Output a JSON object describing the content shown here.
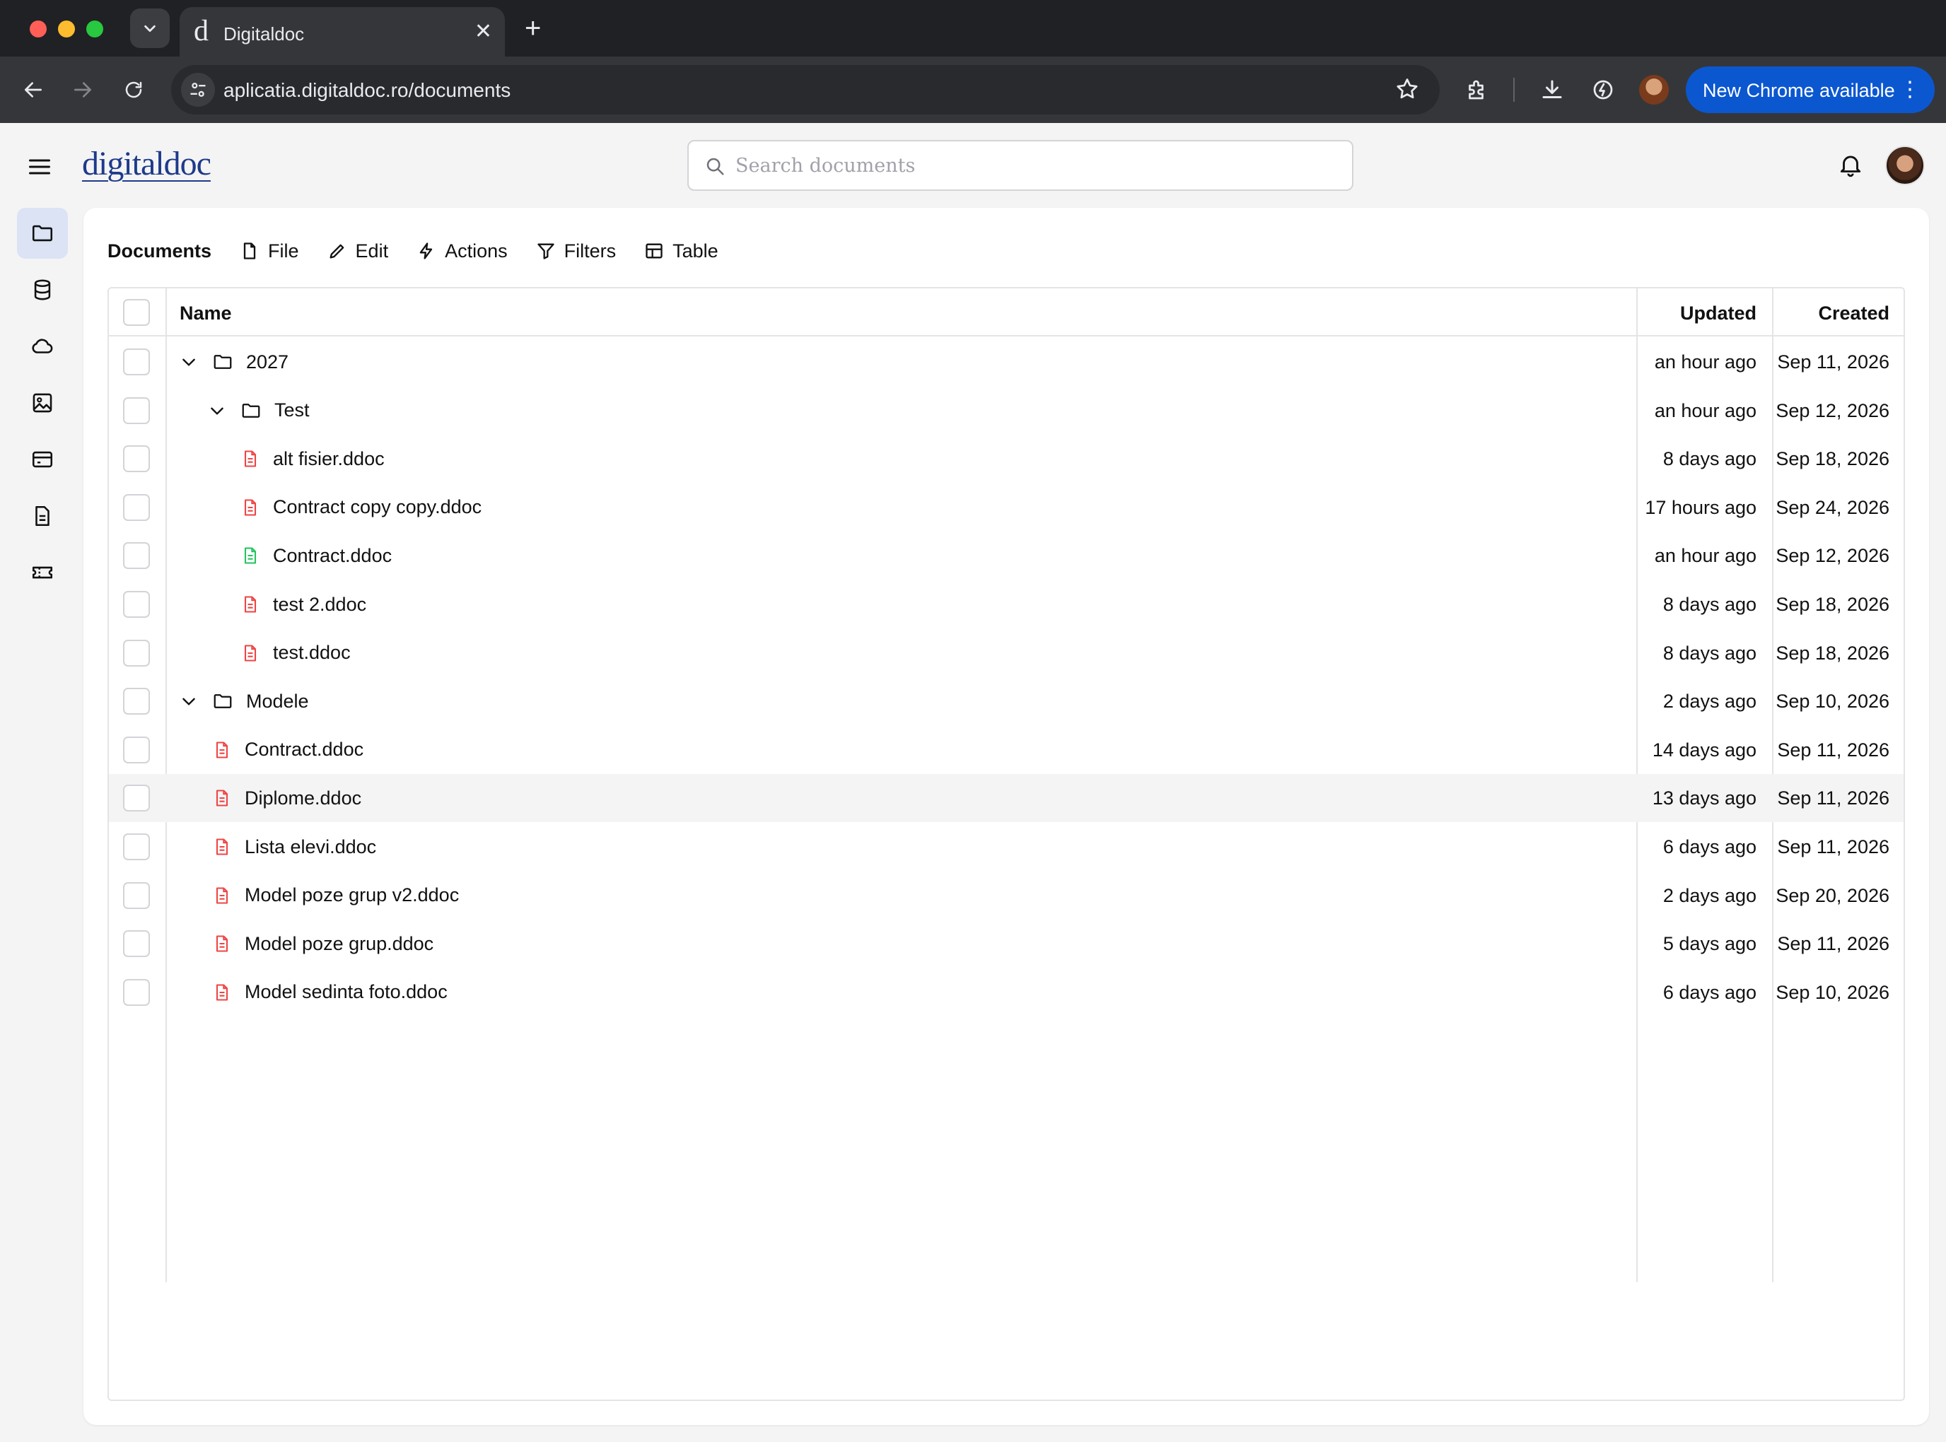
{
  "browser": {
    "tab_title": "Digitaldoc",
    "tab_favicon": "d",
    "url": "aplicatia.digitaldoc.ro/documents",
    "update_button": "New Chrome available"
  },
  "app": {
    "logo": "digitaldoc",
    "search_placeholder": "Search documents"
  },
  "toolbar": {
    "title": "Documents",
    "items": [
      {
        "label": "File",
        "icon": "file-icon"
      },
      {
        "label": "Edit",
        "icon": "pencil-icon"
      },
      {
        "label": "Actions",
        "icon": "lightning-icon"
      },
      {
        "label": "Filters",
        "icon": "filter-icon"
      },
      {
        "label": "Table",
        "icon": "table-icon"
      }
    ]
  },
  "table": {
    "headers": {
      "name": "Name",
      "updated": "Updated",
      "created": "Created"
    },
    "rows": [
      {
        "name": "2027",
        "type": "folder",
        "level": 0,
        "expanded": true,
        "updated": "an hour ago",
        "created": "Sep 11, 2026"
      },
      {
        "name": "Test",
        "type": "folder",
        "level": 1,
        "expanded": true,
        "updated": "an hour ago",
        "created": "Sep 12, 2026"
      },
      {
        "name": "alt fisier.ddoc",
        "type": "file",
        "level": 2,
        "color": "#ef4444",
        "updated": "8 days ago",
        "created": "Sep 18, 2026"
      },
      {
        "name": "Contract copy copy.ddoc",
        "type": "file",
        "level": 2,
        "color": "#ef4444",
        "updated": "17 hours ago",
        "created": "Sep 24, 2026"
      },
      {
        "name": "Contract.ddoc",
        "type": "file",
        "level": 2,
        "color": "#22c55e",
        "updated": "an hour ago",
        "created": "Sep 12, 2026"
      },
      {
        "name": "test 2.ddoc",
        "type": "file",
        "level": 2,
        "color": "#ef4444",
        "updated": "8 days ago",
        "created": "Sep 18, 2026"
      },
      {
        "name": "test.ddoc",
        "type": "file",
        "level": 2,
        "color": "#ef4444",
        "updated": "8 days ago",
        "created": "Sep 18, 2026"
      },
      {
        "name": "Modele",
        "type": "folder",
        "level": 0,
        "expanded": true,
        "updated": "2 days ago",
        "created": "Sep 10, 2026"
      },
      {
        "name": "Contract.ddoc",
        "type": "file",
        "level": 1,
        "color": "#ef4444",
        "updated": "14 days ago",
        "created": "Sep 11, 2026"
      },
      {
        "name": "Diplome.ddoc",
        "type": "file",
        "level": 1,
        "color": "#ef4444",
        "updated": "13 days ago",
        "created": "Sep 11, 2026",
        "highlighted": true
      },
      {
        "name": "Lista elevi.ddoc",
        "type": "file",
        "level": 1,
        "color": "#ef4444",
        "updated": "6 days ago",
        "created": "Sep 11, 2026"
      },
      {
        "name": "Model poze grup v2.ddoc",
        "type": "file",
        "level": 1,
        "color": "#ef4444",
        "updated": "2 days ago",
        "created": "Sep 20, 2026"
      },
      {
        "name": "Model poze grup.ddoc",
        "type": "file",
        "level": 1,
        "color": "#ef4444",
        "updated": "5 days ago",
        "created": "Sep 11, 2026"
      },
      {
        "name": "Model sedinta foto.ddoc",
        "type": "file",
        "level": 1,
        "color": "#ef4444",
        "updated": "6 days ago",
        "created": "Sep 10, 2026"
      }
    ]
  },
  "rail": [
    "folder-icon",
    "database-icon",
    "cloud-icon",
    "image-icon",
    "card-icon",
    "document-icon",
    "ticket-icon"
  ],
  "colors": {
    "accent": "#1e3a8a",
    "chrome_update": "#0b57d0",
    "file_red": "#ef4444",
    "file_green": "#22c55e"
  }
}
